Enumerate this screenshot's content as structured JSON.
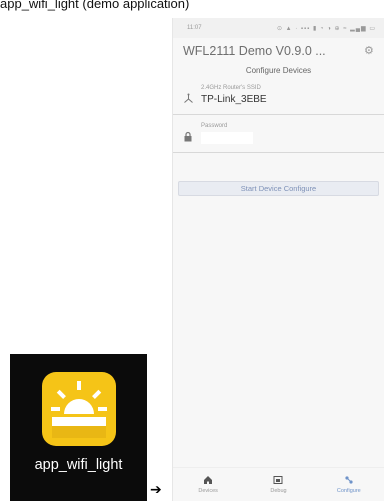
{
  "doc_caption": "app_wifi_light (demo application)",
  "status_bar": {
    "time": "11:07",
    "icons": "⊙ ▲ · ▪▪▪ ▮ ◔ ◑ ⊕ ≈ ▂▄▆ ▭"
  },
  "app": {
    "title": "WFL2111 Demo V0.9.0 ...",
    "settings_icon": "gear-icon",
    "page_title": "Configure Devices"
  },
  "ssid_field": {
    "label": "2.4GHz Router's SSID",
    "value": "TP-Link_3EBE",
    "icon": "wifi-router-icon"
  },
  "password_field": {
    "label": "Password",
    "value": "",
    "icon": "lock-icon"
  },
  "start_button": {
    "label": "Start Device Configure"
  },
  "bottom_nav": {
    "items": [
      {
        "label": "Devices",
        "icon": "home-icon"
      },
      {
        "label": "Debug",
        "icon": "debug-icon"
      },
      {
        "label": "Configure",
        "icon": "configure-icon",
        "active": true
      }
    ]
  },
  "launcher": {
    "label": "app_wifi_light",
    "icon": "sun-lamp-icon",
    "icon_color": "#f5c417"
  },
  "colors": {
    "accent": "#6f93c9",
    "icon_bg": "#f5c417"
  }
}
